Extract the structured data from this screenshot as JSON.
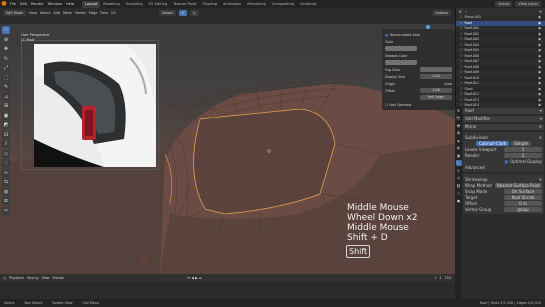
{
  "app": {
    "menus": [
      "File",
      "Edit",
      "Render",
      "Window",
      "Help"
    ],
    "workspace_tabs": [
      "Layout",
      "Modeling",
      "Sculpting",
      "UV Editing",
      "Texture Paint",
      "Shading",
      "Animation",
      "Rendering",
      "Compositing",
      "Scripting"
    ],
    "active_tab": "Layout",
    "scene": "Scene",
    "view_layer": "View Layer"
  },
  "header": {
    "mode": "Edit Mode",
    "view": "View",
    "select": "Select",
    "add": "Add",
    "mesh": "Mesh",
    "vertex": "Vertex",
    "edge": "Edge",
    "face": "Face",
    "uv": "UV",
    "transform": "Global",
    "options": "Options"
  },
  "viewport": {
    "info_line1": "User Perspective",
    "info_line2": "(1) Roof",
    "keys": [
      "Middle Mouse",
      "Wheel Down x2",
      "Middle Mouse",
      "Shift + D"
    ],
    "shift_badge": "Shift"
  },
  "operator_panel": {
    "title": "Recalculated Axes",
    "color_label": "Color",
    "shadow_color_label": "Shadow Color",
    "fog_label": "Fog Color",
    "display_size_label": "Display Size",
    "display_size": "1.00",
    "origin_label": "Origin",
    "origin_value": "Area",
    "offset_label": "Offset",
    "offset_value": "1.00",
    "set_origin": "Set Origin",
    "last_operator": "Last Operator"
  },
  "timeline": {
    "playback": "Playback",
    "keying": "Keying",
    "view": "View",
    "marker": "Marker",
    "frame": "1",
    "start": "1",
    "end": "250"
  },
  "status": {
    "items": [
      "Select",
      "Box Select",
      "Rotate View",
      "Call Menu"
    ],
    "right": "Roof | Verts 2/1,528 | Edges 0/3,024"
  },
  "outliner": {
    "items": [
      {
        "name": "Plane.005",
        "sel": false
      },
      {
        "name": "Roof",
        "sel": true
      },
      {
        "name": "Roof.001",
        "sel": false
      },
      {
        "name": "Roof.002",
        "sel": false
      },
      {
        "name": "Roof.003",
        "sel": false
      },
      {
        "name": "Roof.004",
        "sel": false
      },
      {
        "name": "Roof.005",
        "sel": false
      },
      {
        "name": "Roof.006",
        "sel": false
      },
      {
        "name": "Roof.007",
        "sel": false
      },
      {
        "name": "Roof.008",
        "sel": false
      },
      {
        "name": "Roof.009",
        "sel": false
      },
      {
        "name": "Roof.010",
        "sel": false
      },
      {
        "name": "Roof.011",
        "sel": false
      },
      {
        "name": "Shell",
        "sel": false
      },
      {
        "name": "Roof.012",
        "sel": false
      },
      {
        "name": "Roof.013",
        "sel": false
      },
      {
        "name": "Roof.014",
        "sel": false
      }
    ]
  },
  "properties": {
    "object": "Roof",
    "modifier_header": "Add Modifier",
    "mod1_name": "Mirror",
    "mod2_name": "Subdivision",
    "catmull": "Catmull-Clark",
    "simple": "Simple",
    "levels_label": "Levels Viewport",
    "levels_value": "1",
    "render_label": "Render",
    "render_value": "2",
    "optimal": "Optimal Display",
    "advanced": "Advanced",
    "mod3_name": "Shrinkwrap",
    "wrap_method_label": "Wrap Method",
    "wrap_method": "Nearest Surface Point",
    "snap_mode_label": "Snap Mode",
    "snap_mode": "On Surface",
    "target_label": "Target",
    "target": "Roof Shrink",
    "offset_label": "Offset",
    "offset": "0 m",
    "vgroup_label": "Vertex Group",
    "vgroup": "group"
  },
  "colors": {
    "accent": "#4772b3",
    "orange": "#e87d0d",
    "car_body": "#5e4740"
  }
}
